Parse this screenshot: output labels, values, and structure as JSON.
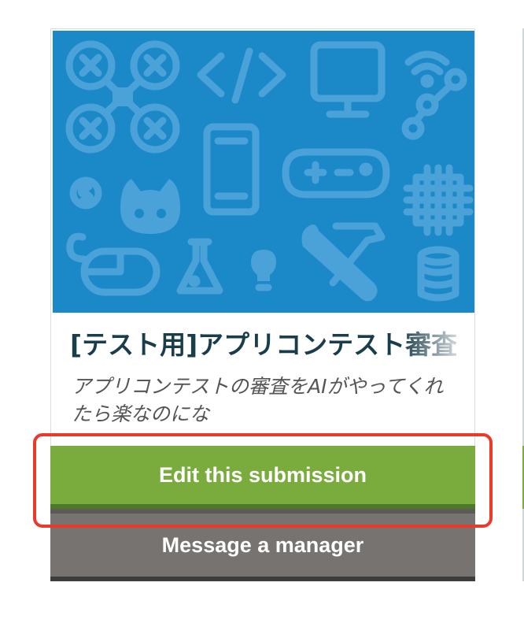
{
  "card": {
    "title": "[テスト用]アプリコンテスト審査",
    "description": "アプリコンテストの審査をAIがやってくれたら楽なのにな",
    "banner_icons": [
      "drone-icon",
      "code-icon",
      "monitor-icon",
      "wifi-icon",
      "circuit-icon",
      "smartphone-icon",
      "gamepad-icon",
      "dollar-icon",
      "octocat-icon",
      "chip-icon",
      "mouse-icon",
      "flask-icon",
      "lightbulb-icon",
      "tools-icon",
      "database-icon"
    ]
  },
  "buttons": {
    "edit": "Edit this submission",
    "message": "Message a manager"
  },
  "colors": {
    "banner": "#1b88c8",
    "banner_icon": "#4aa2d8",
    "edit_button": "#7aac3d",
    "message_button": "#777371",
    "highlight": "#ea3a2c",
    "title": "#1a3d4c"
  }
}
